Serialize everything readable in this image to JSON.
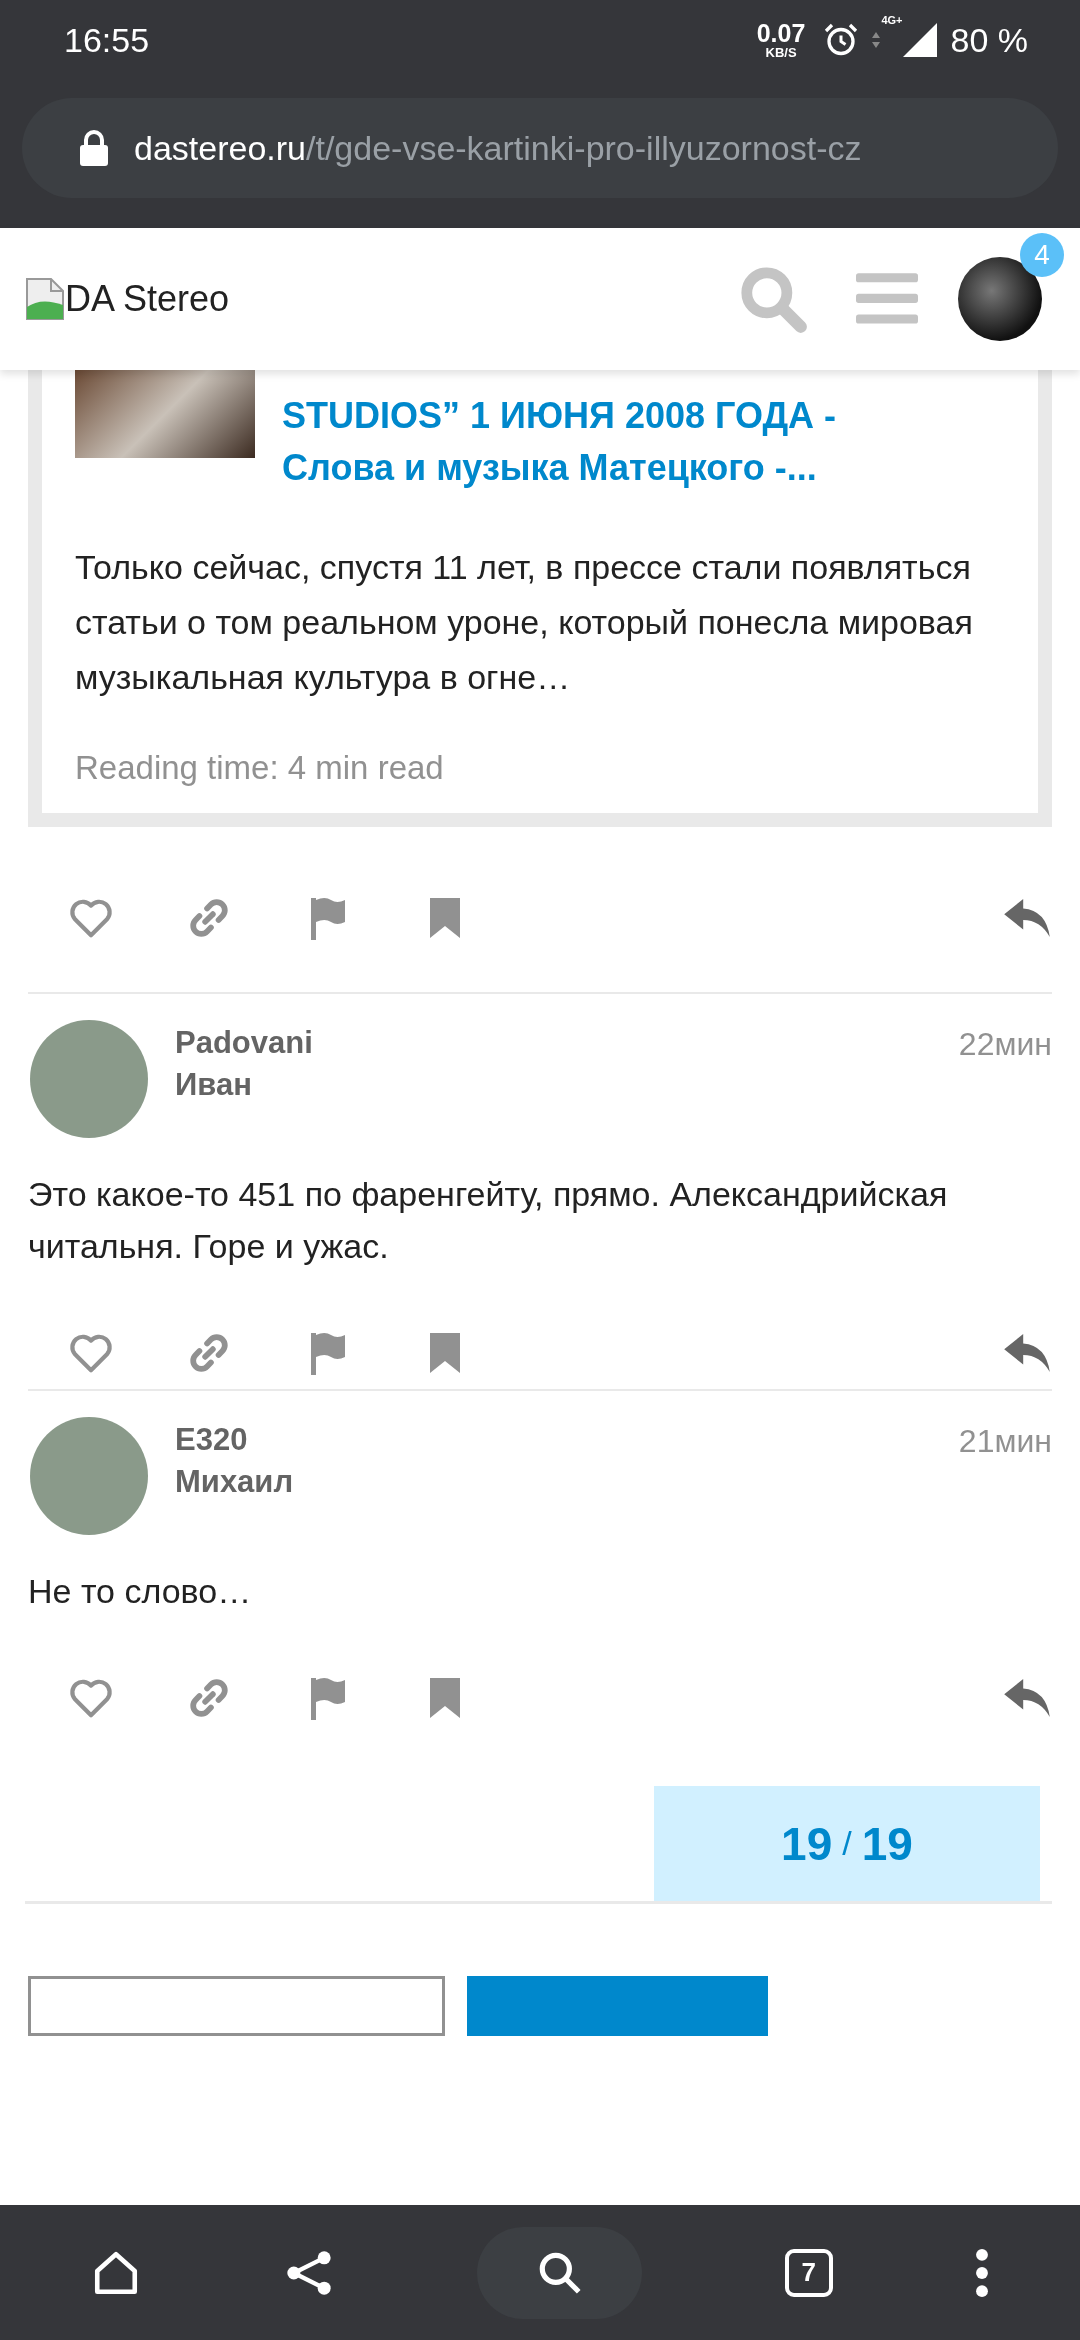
{
  "status_bar": {
    "time": "16:55",
    "net_speed": "0.07",
    "net_unit": "KB/S",
    "network": "4G+",
    "battery": "80 %"
  },
  "address_bar": {
    "domain": "dastereo.ru",
    "path": "/t/gde-vse-kartinki-pro-illyuzornost-cz"
  },
  "header": {
    "logo_alt": "DA Stereo",
    "notification_count": "4"
  },
  "onebox": {
    "title_lines": [
      "STUDIOS” 1 ИЮНЯ 2008 ГОДА -",
      "Слова и музыка Матецкого -..."
    ],
    "excerpt": "Только сейчас, спустя 11 лет, в прессе стали появляться статьи о том реальном уроне, который понесла мировая музыкальная культура в огне…",
    "reading_time": "Reading time: 4 min read"
  },
  "posts": [
    {
      "username": "Padovani",
      "name": "Иван",
      "time": "22мин",
      "text": "Это какое-то 451 по фаренгейту, прямо. Александрийская читальня. Горе и ужас."
    },
    {
      "username": "E320",
      "name": "Михаил",
      "time": "21мин",
      "text": "Не то слово…"
    }
  ],
  "progress": {
    "current": "19",
    "separator": "/",
    "total": "19"
  },
  "bottom_nav": {
    "tab_count": "7"
  }
}
